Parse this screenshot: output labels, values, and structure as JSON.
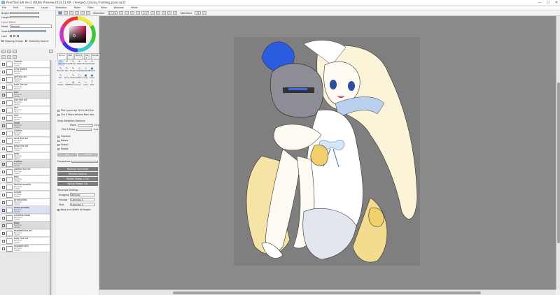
{
  "window": {
    "title": "PaintTool SAI Ver.2 (64bit) Preview.2023.11.09 - [merged_canvas / holding_pose.sai2]",
    "minimize": "—",
    "maximize": "☐",
    "close": "✕"
  },
  "menu": [
    "File",
    "Edit",
    "Canvas",
    "Layer",
    "Selection",
    "Ruler",
    "Filter",
    "View",
    "Window",
    "Other"
  ],
  "toolbar": {
    "selection_label": "Selection",
    "selection_zoom": "17.0%",
    "zoom_value": "0.0°",
    "stabilizer_label": "Stabilizer",
    "stabilizer_value": "15"
  },
  "properties": {
    "hue_label": "Bright",
    "saturation_label": "Length",
    "layer_effect_label": "Layer Effect",
    "mode_label": "Mode",
    "mode_value": "Normal",
    "opacity_label": "Opacity",
    "opacity_value": "100%",
    "lock_label": "Lock",
    "clipping_label": "Clipping Group",
    "selection_source_label": "Selection Source"
  },
  "layers": [
    {
      "name": "Frames",
      "mode": "Normal",
      "opacity": "100%",
      "type": "layer"
    },
    {
      "name": "eyes sketch",
      "mode": "Normal",
      "opacity": "100%",
      "type": "layer"
    },
    {
      "name": "self line art",
      "mode": "Normal",
      "opacity": "100%",
      "type": "layer"
    },
    {
      "name": "bulb line art",
      "mode": "Normal",
      "opacity": "100%",
      "type": "layer"
    },
    {
      "name": "hair",
      "mode": "Normal",
      "opacity": "100%",
      "type": "folder"
    },
    {
      "name": "hair line art",
      "mode": "Normal",
      "opacity": "100%",
      "type": "layer"
    },
    {
      "name": "veil",
      "mode": "Normal",
      "opacity": "71%",
      "type": "layer"
    },
    {
      "name": "hair",
      "mode": "Normal",
      "opacity": "100%",
      "type": "layer"
    },
    {
      "name": "head",
      "mode": "Normal",
      "opacity": "100%",
      "type": "folder"
    },
    {
      "name": "clothes",
      "mode": "Normal",
      "opacity": "100%",
      "type": "layer"
    },
    {
      "name": "neck line art",
      "mode": "Normal",
      "opacity": "100%",
      "type": "layer"
    },
    {
      "name": "head line art",
      "mode": "Normal",
      "opacity": "100%",
      "type": "layer"
    },
    {
      "name": "eyes",
      "mode": "Normal",
      "opacity": "100%",
      "type": "layer"
    },
    {
      "name": "clothes",
      "mode": "Normal",
      "opacity": "100%",
      "type": "folder"
    },
    {
      "name": "clothes line art",
      "mode": "Normal",
      "opacity": "100%",
      "type": "layer"
    },
    {
      "name": "bow",
      "mode": "Normal",
      "opacity": "100%",
      "type": "layer"
    },
    {
      "name": "behind accents",
      "mode": "Normal",
      "opacity": "100%",
      "type": "layer"
    },
    {
      "name": "knight",
      "mode": "Normal",
      "opacity": "100%",
      "type": "layer"
    },
    {
      "name": "accessories",
      "mode": "Normal",
      "opacity": "100%",
      "type": "layer"
    },
    {
      "name": "dress accents",
      "mode": "Normal",
      "opacity": "100%",
      "type": "layer",
      "selected": true
    },
    {
      "name": "wedding dress",
      "mode": "Normal",
      "opacity": "100%",
      "type": "layer"
    },
    {
      "name": "body",
      "mode": "Normal",
      "opacity": "100%",
      "type": "folder"
    },
    {
      "name": "exposed line art",
      "mode": "Normal",
      "opacity": "100%",
      "type": "layer"
    },
    {
      "name": "body line art",
      "mode": "Normal",
      "opacity": "100%",
      "type": "layer"
    },
    {
      "name": "exposed skin",
      "mode": "Normal",
      "opacity": "100%",
      "type": "layer"
    }
  ],
  "tool_tabs": [
    "Brush",
    "Pen",
    "Blurry",
    "Ink 1",
    "Inside"
  ],
  "tools": [
    {
      "name": "Pen",
      "icon": "✎"
    },
    {
      "name": "Airbrush",
      "icon": "✐"
    },
    {
      "name": "Brush",
      "icon": "✎"
    },
    {
      "name": "Water",
      "icon": "✒"
    },
    {
      "name": "Marker",
      "icon": "✏"
    },
    {
      "name": "Eraser",
      "icon": "▭"
    },
    {
      "name": "Blender",
      "icon": "✎"
    },
    {
      "name": "Blur",
      "icon": "✎"
    },
    {
      "name": "Binary",
      "icon": "✎"
    },
    {
      "name": "Select",
      "icon": "◇"
    },
    {
      "name": "Deselect",
      "icon": "◇"
    },
    {
      "name": "Bucket",
      "icon": "▣"
    },
    {
      "name": "Pen",
      "icon": "✎"
    },
    {
      "name": "Spray",
      "icon": "∴"
    },
    {
      "name": "Sketch",
      "icon": "✎"
    },
    {
      "name": "Outline",
      "icon": "▢"
    },
    {
      "name": "Grey",
      "icon": "▣"
    },
    {
      "name": "Color",
      "icon": "▣"
    },
    {
      "name": "Smear",
      "icon": "≈"
    },
    {
      "name": "Soft",
      "icon": "◌"
    },
    {
      "name": "Watercolor",
      "icon": "◍"
    },
    {
      "name": "Ink",
      "icon": "✒"
    },
    {
      "name": "Lasso",
      "icon": "∿"
    },
    {
      "name": "Text",
      "icon": "T"
    }
  ],
  "tool_options": {
    "pick_layers": "Pick Layers by Ctrl+Left Click",
    "pick_move": "Ctrl & Move without Mod. Key",
    "snap_label": "Snap Detection Distance",
    "move_label": "Move",
    "move_value": "20 px",
    "pick_move_label": "Pick & Move",
    "pick_move_value": "4 px",
    "freeform": "Freeform",
    "rotate": "Rotate",
    "distort": "Distort",
    "mirror": "Mobile",
    "ok": "OK",
    "cancel": "Cancel",
    "perspective_label": "Perspective",
    "reverse_h": "Reverse Horizontal",
    "reverse_v": "Reverse Vertical",
    "rotate_ccw": "Rotate 90deg. CCW",
    "rotate_cw": "Rotate 90deg. CW",
    "resample_label": "Resample Settings",
    "dragging_label": "Dragging",
    "dragging_value": "Bilinear",
    "preview_label": "Preview",
    "preview_value": "Lanczos 3",
    "final_label": "Final",
    "final_value": "Lanczos 3",
    "keep_width": "Keep Line Width of Shapes"
  },
  "colors": {
    "canvas_bg": "#8b8b8b",
    "art_bg": "#7f7f7f",
    "accent": "#5b8ed4"
  }
}
